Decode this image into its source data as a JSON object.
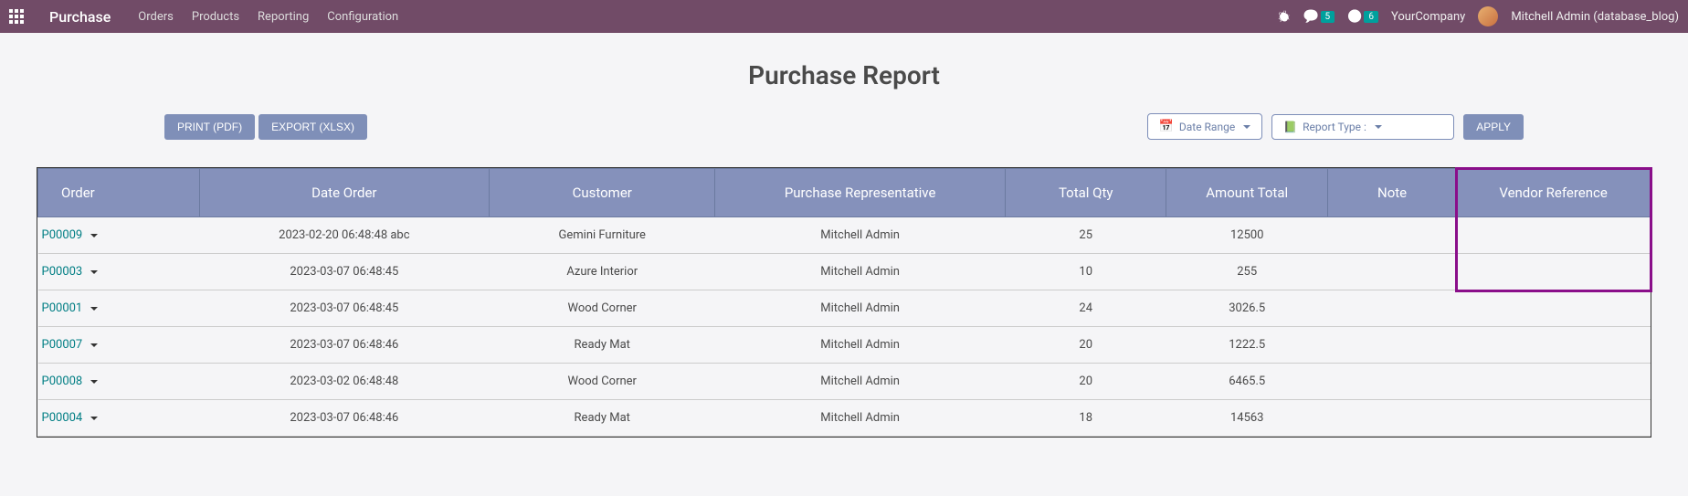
{
  "navbar": {
    "app_name": "Purchase",
    "menu": [
      "Orders",
      "Products",
      "Reporting",
      "Configuration"
    ],
    "chat_badge": "5",
    "clock_badge": "6",
    "company": "YourCompany",
    "user": "Mitchell Admin (database_blog)"
  },
  "page": {
    "title": "Purchase Report"
  },
  "toolbar": {
    "print_label": "PRINT (PDF)",
    "export_label": "EXPORT (XLSX)",
    "date_range_label": "Date Range",
    "report_type_label": "Report Type :",
    "apply_label": "APPLY"
  },
  "table": {
    "headers": {
      "order": "Order",
      "date_order": "Date Order",
      "customer": "Customer",
      "representative": "Purchase Representative",
      "total_qty": "Total Qty",
      "amount_total": "Amount Total",
      "note": "Note",
      "vendor_reference": "Vendor Reference"
    },
    "rows": [
      {
        "order": "P00009",
        "date": "2023-02-20 06:48:48 abc",
        "customer": "Gemini Furniture",
        "rep": "Mitchell Admin",
        "qty": "25",
        "amount": "12500",
        "note": "",
        "vendor_ref": ""
      },
      {
        "order": "P00003",
        "date": "2023-03-07 06:48:45",
        "customer": "Azure Interior",
        "rep": "Mitchell Admin",
        "qty": "10",
        "amount": "255",
        "note": "",
        "vendor_ref": ""
      },
      {
        "order": "P00001",
        "date": "2023-03-07 06:48:45",
        "customer": "Wood Corner",
        "rep": "Mitchell Admin",
        "qty": "24",
        "amount": "3026.5",
        "note": "",
        "vendor_ref": ""
      },
      {
        "order": "P00007",
        "date": "2023-03-07 06:48:46",
        "customer": "Ready Mat",
        "rep": "Mitchell Admin",
        "qty": "20",
        "amount": "1222.5",
        "note": "",
        "vendor_ref": ""
      },
      {
        "order": "P00008",
        "date": "2023-03-02 06:48:48",
        "customer": "Wood Corner",
        "rep": "Mitchell Admin",
        "qty": "20",
        "amount": "6465.5",
        "note": "",
        "vendor_ref": ""
      },
      {
        "order": "P00004",
        "date": "2023-03-07 06:48:46",
        "customer": "Ready Mat",
        "rep": "Mitchell Admin",
        "qty": "18",
        "amount": "14563",
        "note": "",
        "vendor_ref": ""
      }
    ]
  }
}
